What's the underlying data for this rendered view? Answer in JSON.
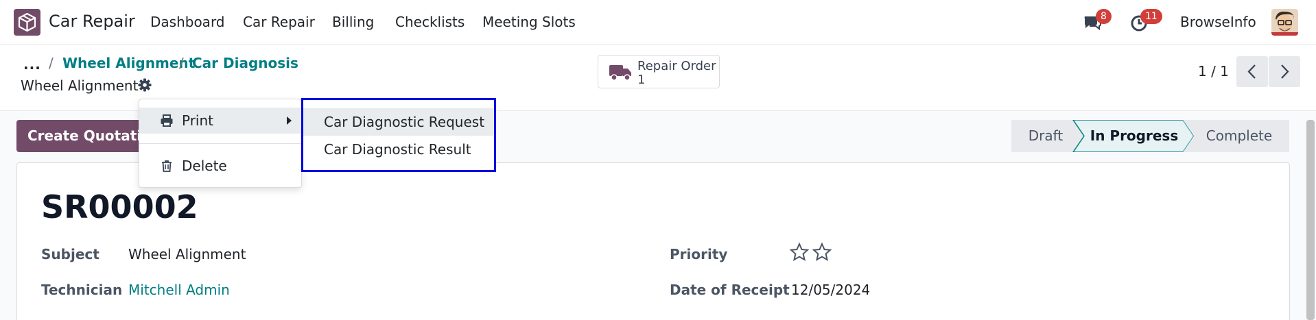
{
  "app": {
    "name": "Car Repair"
  },
  "nav": {
    "menu": [
      "Dashboard",
      "Car Repair",
      "Billing",
      "Checklists",
      "Meeting Slots"
    ],
    "messages_count": "8",
    "activities_count": "11",
    "company": "BrowseInfo"
  },
  "breadcrumb": {
    "dots": "...",
    "items": [
      "Wheel Alignment",
      "Car Diagnosis"
    ],
    "separator": "/"
  },
  "record": {
    "title": "Wheel Alignment",
    "reference": "SR00002"
  },
  "smart_button": {
    "label": "Repair Order",
    "value": "1"
  },
  "pager": {
    "text": "1 / 1"
  },
  "actions": {
    "create_quotation": "Create Quotation"
  },
  "statusbar": {
    "stages": [
      "Draft",
      "In Progress",
      "Complete"
    ],
    "current": "In Progress"
  },
  "fields": {
    "subject_label": "Subject",
    "subject_value": "Wheel Alignment",
    "technician_label": "Technician",
    "technician_value": "Mitchell Admin",
    "priority_label": "Priority",
    "priority_stars_filled": 0,
    "priority_stars_total": 2,
    "date_label": "Date of Receipt",
    "date_value": "12/05/2024"
  },
  "action_menu": {
    "print_label": "Print",
    "delete_label": "Delete",
    "print_submenu": [
      "Car Diagnostic Request",
      "Car Diagnostic Result"
    ]
  },
  "colors": {
    "brand": "#714b67",
    "link": "#017e84",
    "badge": "#d23f3a",
    "highlight_border": "#0000dd"
  }
}
